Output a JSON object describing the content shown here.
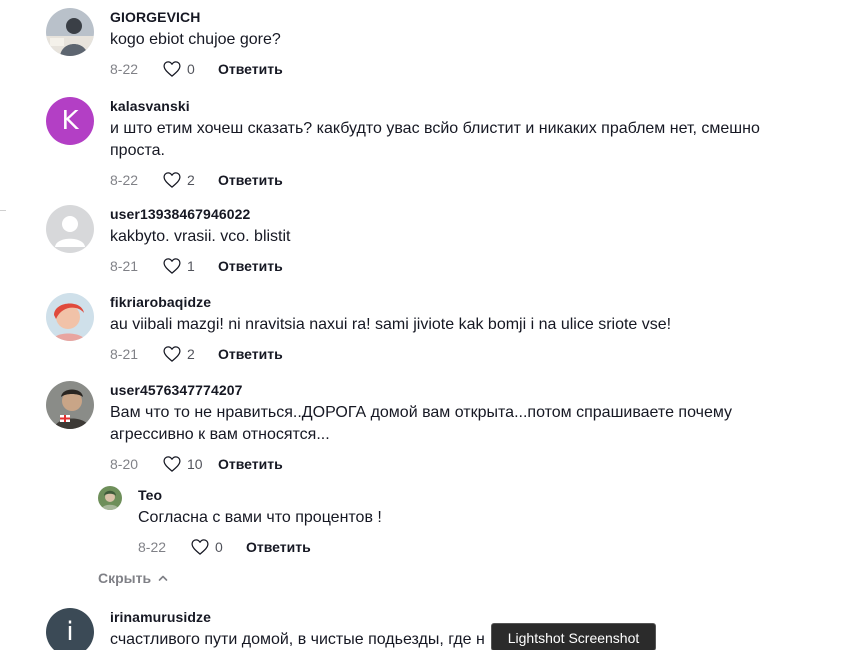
{
  "comments": [
    {
      "username": "GIORGEVICH",
      "text": "kogo ebiot chujoe gore?",
      "date": "8-22",
      "likes": "0",
      "reply_label": "Ответить",
      "avatar": {
        "type": "photo",
        "colors": [
          "#9aa3ae",
          "#5d6570",
          "#e7e3dc"
        ]
      }
    },
    {
      "username": "kalasvanski",
      "text": "и што етим хочеш сказать? какбудто увас всйо блистит и никаких праблем нет, смешно проста.",
      "date": "8-22",
      "likes": "2",
      "reply_label": "Ответить",
      "avatar": {
        "type": "letter",
        "letter": "K",
        "color": "#b33fc5"
      }
    },
    {
      "username": "user13938467946022",
      "text": "kakbyto. vrasii. vco. blistit",
      "date": "8-21",
      "likes": "1",
      "reply_label": "Ответить",
      "avatar": {
        "type": "default",
        "color": "#d7d8da"
      }
    },
    {
      "username": "fikriarobaqidze",
      "text": "au viibali mazgi! ni nravitsia naxui ra! sami jiviote kak bomji i na ulice sriote vse!",
      "date": "8-21",
      "likes": "2",
      "reply_label": "Ответить",
      "avatar": {
        "type": "photo",
        "colors": [
          "#e04a3c",
          "#f1c2a8",
          "#a6c7d8"
        ]
      }
    },
    {
      "username": "user4576347774207",
      "text": "Вам что то не нравиться..ДОРОГА домой вам открыта...потом спрашиваете почему агрессивно к вам относятся...",
      "date": "8-20",
      "likes": "10",
      "reply_label": "Ответить",
      "avatar": {
        "type": "photo",
        "colors": [
          "#3d3a36",
          "#c9a587",
          "#e23030"
        ]
      }
    }
  ],
  "reply": {
    "username": "Teo",
    "text": "Согласна с вами что процентов !",
    "date": "8-22",
    "likes": "0",
    "reply_label": "Ответить",
    "avatar": {
      "type": "photo",
      "colors": [
        "#6e8f5a",
        "#d9c2a8",
        "#3f5b39"
      ]
    }
  },
  "hide_replies_label": "Скрыть",
  "last_comment": {
    "username": "irinamurusidze",
    "text": "счастливого пути домой, в чистые подьезды, где н",
    "avatar": {
      "type": "letter",
      "letter": "i",
      "color": "#3b4a56"
    }
  },
  "tooltip": "Lightshot Screenshot",
  "colors": {
    "text_primary": "#161823",
    "text_secondary": "rgba(22,24,35,0.55)"
  }
}
